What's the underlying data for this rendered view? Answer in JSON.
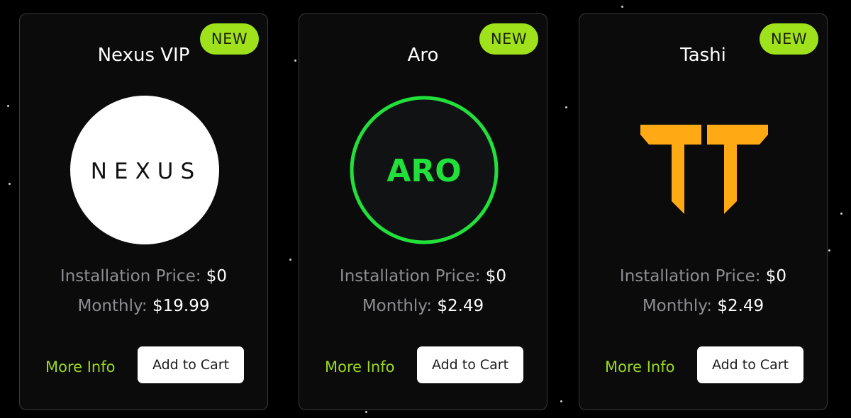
{
  "products": [
    {
      "badge": "NEW",
      "name": "Nexus VIP",
      "logo_text": "NEXUS",
      "install_label": "Installation Price:",
      "install_price": "$0",
      "monthly_label": "Monthly:",
      "monthly_price": "$19.99",
      "more_info_label": "More Info",
      "add_to_cart_label": "Add to Cart"
    },
    {
      "badge": "NEW",
      "name": "Aro",
      "logo_text": "ARO",
      "install_label": "Installation Price:",
      "install_price": "$0",
      "monthly_label": "Monthly:",
      "monthly_price": "$2.49",
      "more_info_label": "More Info",
      "add_to_cart_label": "Add to Cart"
    },
    {
      "badge": "NEW",
      "name": "Tashi",
      "logo_text": "",
      "install_label": "Installation Price:",
      "install_price": "$0",
      "monthly_label": "Monthly:",
      "monthly_price": "$2.49",
      "more_info_label": "More Info",
      "add_to_cart_label": "Add to Cart"
    }
  ],
  "colors": {
    "background": "#000000",
    "card": "#0b0b0c",
    "card_border": "#3a3a3c",
    "badge": "#9fe21c",
    "accent_link": "#9ad81f",
    "aro_green": "#22e03a",
    "tashi_orange": "#ffa914"
  },
  "icons": {
    "nexus": "nexus-logo",
    "aro": "aro-logo",
    "tashi": "tashi-logo"
  }
}
